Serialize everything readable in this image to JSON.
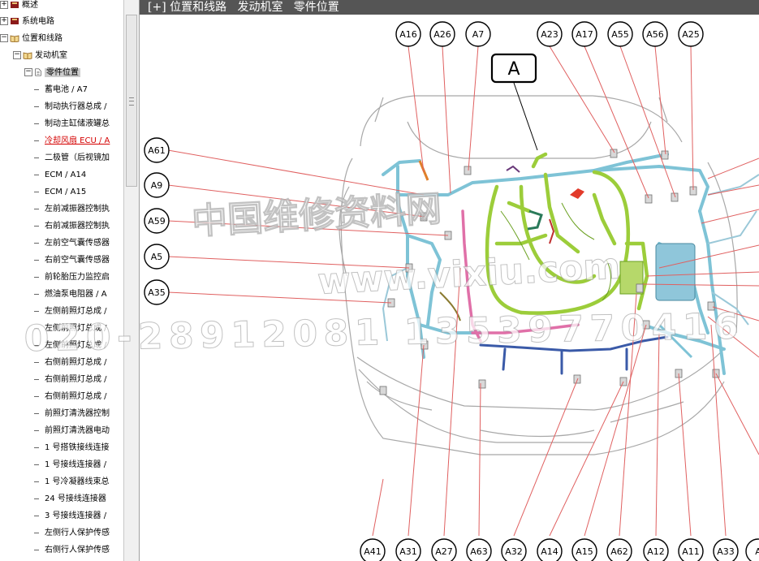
{
  "tree": {
    "top": [
      {
        "label": "概述",
        "icon": "closed-book-icon"
      },
      {
        "label": "系统电路",
        "icon": "closed-book-icon"
      },
      {
        "label": "位置和线路",
        "icon": "open-book-icon"
      },
      {
        "label": "发动机室",
        "icon": "open-book-icon"
      },
      {
        "label": "零件位置",
        "icon": "document-icon"
      }
    ],
    "leaves": [
      "蓄电池 / A7",
      "制动执行器总成 /",
      "制动主缸储液罐总",
      "冷却风扇 ECU / A",
      "二极管（后视镜加",
      "ECM / A14",
      "ECM / A15",
      "左前减振器控制执",
      "右前减振器控制执",
      "左前空气囊传感器",
      "右前空气囊传感器",
      "前轮胎压力监控启",
      "燃油泵电阻器 / A",
      "左侧前照灯总成 /",
      "左侧前照灯总成 /",
      "左侧前照灯总成 /",
      "右侧前照灯总成 /",
      "右侧前照灯总成 /",
      "右侧前照灯总成 /",
      "前照灯清洗器控制",
      "前照灯清洗器电动",
      "1 号搭铁接线连接",
      "1 号接线连接器 /",
      "1 号冷凝器线束总",
      "24 号接线连接器",
      "3 号接线连接器 /",
      "左侧行人保护传感",
      "右侧行人保护传感"
    ]
  },
  "title": "[+] 位置和线路   发动机室   零件位置",
  "diagram": {
    "callout_main": "A",
    "top_labels": [
      "A16",
      "A26",
      "A7",
      "A23",
      "A17",
      "A55",
      "A56",
      "A25"
    ],
    "left_labels": [
      "A61",
      "A9",
      "A59",
      "A5",
      "A35"
    ],
    "bottom_labels": [
      "A41",
      "A31",
      "A27",
      "A63",
      "A32",
      "A14",
      "A15",
      "A62",
      "A12",
      "A11",
      "A33",
      "A"
    ]
  },
  "watermark": {
    "line1": "中国维修资料网",
    "line2": "www.vixiu.com",
    "line3": "020-28912081 13539770416"
  },
  "colors": {
    "leader": "#e06060",
    "harness_green": "#9ccd3a",
    "harness_blue": "#7ec3d6",
    "harness_pink": "#e070a8",
    "harness_navy": "#3a5aa8",
    "highlight_red": "#d40000"
  }
}
